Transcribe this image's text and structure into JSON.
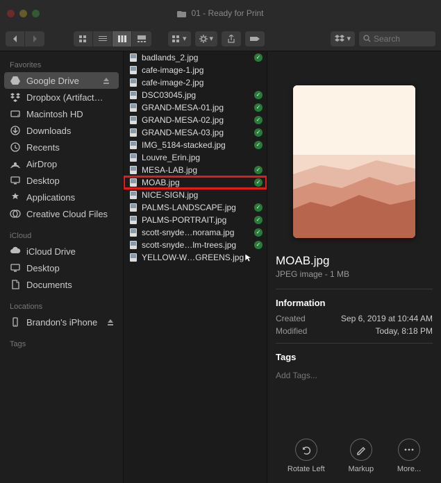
{
  "window": {
    "title": "01 - Ready for Print",
    "search_placeholder": "Search"
  },
  "sidebar": {
    "sections": [
      {
        "heading": "Favorites",
        "items": [
          {
            "label": "Google Drive",
            "icon": "gdrive",
            "selected": true,
            "eject": true
          },
          {
            "label": "Dropbox (Artifact…",
            "icon": "dropbox"
          },
          {
            "label": "Macintosh HD",
            "icon": "hd"
          },
          {
            "label": "Downloads",
            "icon": "downloads"
          },
          {
            "label": "Recents",
            "icon": "recents"
          },
          {
            "label": "AirDrop",
            "icon": "airdrop"
          },
          {
            "label": "Desktop",
            "icon": "desktop"
          },
          {
            "label": "Applications",
            "icon": "applications"
          },
          {
            "label": "Creative Cloud Files",
            "icon": "cc"
          }
        ]
      },
      {
        "heading": "iCloud",
        "items": [
          {
            "label": "iCloud Drive",
            "icon": "icloud"
          },
          {
            "label": "Desktop",
            "icon": "desktop"
          },
          {
            "label": "Documents",
            "icon": "documents"
          }
        ]
      },
      {
        "heading": "Locations",
        "items": [
          {
            "label": "Brandon's iPhone",
            "icon": "iphone",
            "eject": true
          }
        ]
      },
      {
        "heading": "Tags",
        "items": []
      }
    ]
  },
  "files": [
    {
      "name": "badlands_2.jpg",
      "synced": true
    },
    {
      "name": "cafe-image-1.jpg"
    },
    {
      "name": "cafe-image-2.jpg"
    },
    {
      "name": "DSC03045.jpg",
      "synced": true
    },
    {
      "name": "GRAND-MESA-01.jpg",
      "synced": true
    },
    {
      "name": "GRAND-MESA-02.jpg",
      "synced": true
    },
    {
      "name": "GRAND-MESA-03.jpg",
      "synced": true
    },
    {
      "name": "IMG_5184-stacked.jpg",
      "synced": true
    },
    {
      "name": "Louvre_Erin.jpg"
    },
    {
      "name": "MESA-LAB.jpg",
      "synced": true
    },
    {
      "name": "MOAB.jpg",
      "synced": true,
      "highlight": true
    },
    {
      "name": "NICE-SIGN.jpg"
    },
    {
      "name": "PALMS-LANDSCAPE.jpg",
      "synced": true
    },
    {
      "name": "PALMS-PORTRAIT.jpg",
      "synced": true
    },
    {
      "name": "scott-snyde…norama.jpg",
      "synced": true
    },
    {
      "name": "scott-snyde…lm-trees.jpg",
      "synced": true
    },
    {
      "name": "YELLOW-W…GREENS.jpg",
      "cursor": true
    }
  ],
  "preview": {
    "name": "MOAB.jpg",
    "kind": "JPEG image - 1 MB",
    "info_heading": "Information",
    "created_label": "Created",
    "created_value": "Sep 6, 2019 at 10:44 AM",
    "modified_label": "Modified",
    "modified_value": "Today, 8:18 PM",
    "tags_heading": "Tags",
    "add_tags": "Add Tags...",
    "actions": {
      "rotate": "Rotate Left",
      "markup": "Markup",
      "more": "More..."
    }
  }
}
